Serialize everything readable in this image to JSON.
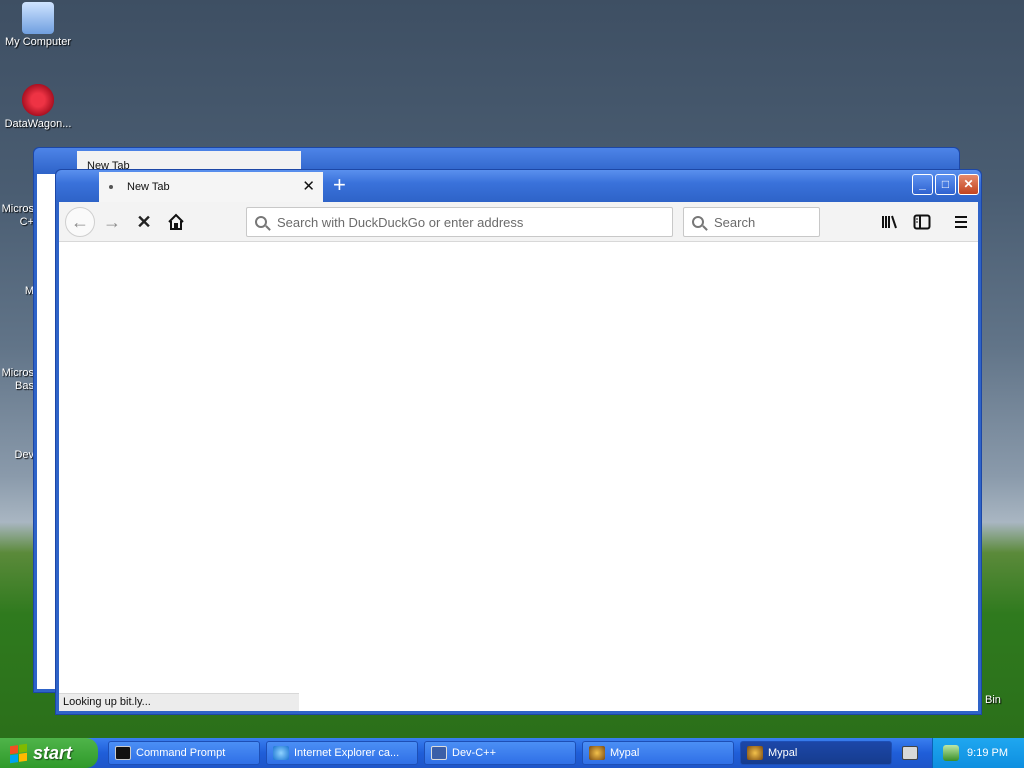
{
  "desktop": {
    "icons": [
      {
        "label": "My Computer"
      },
      {
        "label": "DataWagon..."
      }
    ],
    "clipped_labels": [
      "Micros",
      "C+",
      "M",
      "Micros",
      "Bas",
      "Dev"
    ],
    "recycle_label": "Bin"
  },
  "browser_back": {
    "tab_label": "New Tab"
  },
  "browser": {
    "tab_label": "New Tab",
    "newtab_symbol": "+",
    "url_placeholder": "Search with DuckDuckGo or enter address",
    "search_placeholder": "Search",
    "status_text": "Looking up bit.ly...",
    "buttons": {
      "minimize": "_",
      "maximize": "□",
      "close": "✕"
    }
  },
  "taskbar": {
    "start_label": "start",
    "tasks": [
      {
        "label": "Command Prompt"
      },
      {
        "label": "Internet Explorer ca..."
      },
      {
        "label": "Dev-C++"
      },
      {
        "label": "Mypal"
      },
      {
        "label": "Mypal"
      }
    ],
    "clock": "9:19 PM"
  }
}
